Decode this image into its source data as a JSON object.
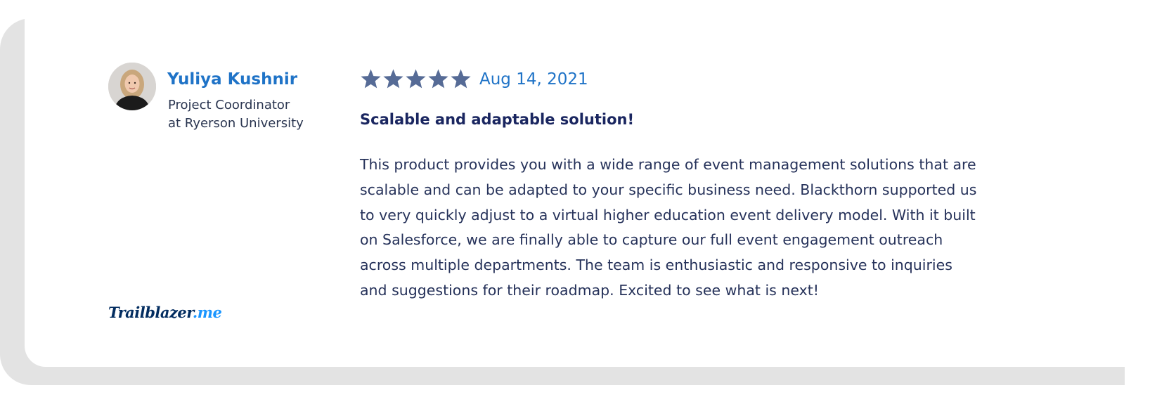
{
  "reviewer": {
    "name": "Yuliya Kushnir",
    "title_line1": "Project Coordinator",
    "title_line2": "at Ryerson University"
  },
  "review": {
    "rating": 5,
    "rating_max": 5,
    "date": "Aug 14, 2021",
    "title": "Scalable and adaptable solution!",
    "body_lines": [
      "This product provides you with a wide range of event management solutions that are",
      "scalable and can be adapted to your specific business need. Blackthorn supported us",
      "to very quickly adjust to a virtual higher education event delivery model. With it built",
      "on Salesforce, we are finally able to capture our full event engagement outreach",
      "across multiple departments. The team is enthusiastic and responsive to inquiries",
      "and suggestions for their roadmap. Excited to see what is next!"
    ]
  },
  "logo": {
    "text_main": "Trailblazer",
    "text_suffix": ".me"
  },
  "colors": {
    "accent": "#1f73c7",
    "star": "#566b96",
    "heading": "#1a2660",
    "body_text": "#26325a",
    "backdrop": "#e3e3e3"
  },
  "icons": {
    "rating": "star-icon",
    "avatar": "user-photo"
  }
}
